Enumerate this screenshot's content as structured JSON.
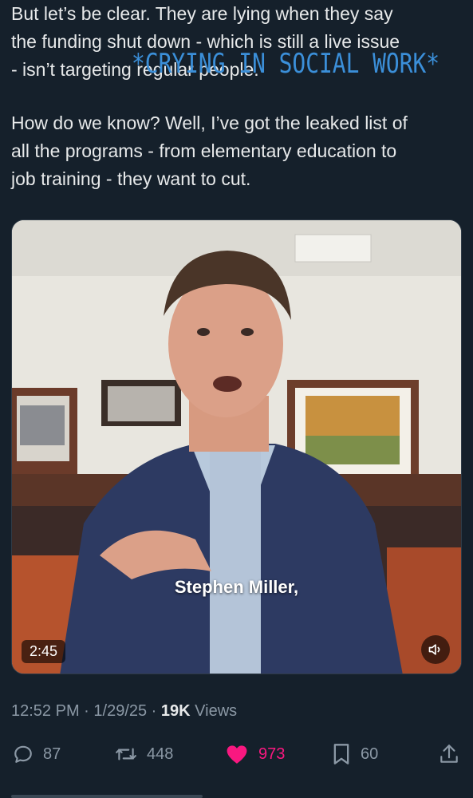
{
  "tweet": {
    "lines": [
      "But let’s be clear. They are lying when they say",
      "the funding shut down - which is still a live issue",
      "- isn’t targeting regular people."
    ],
    "lines2": [
      "How do we know? Well, I’ve got the leaked list of",
      "all the programs - from elementary education to",
      "job training - they want to cut."
    ]
  },
  "overlay": {
    "caption": "*CRYING IN SOCIAL WORK*"
  },
  "video": {
    "subtitle": "Stephen Miller,",
    "duration": "2:45",
    "mute_icon": "speaker-muted-icon"
  },
  "meta": {
    "time": "12:52 PM",
    "date": "1/29/25",
    "separator": " · ",
    "views_count": "19K",
    "views_label": "Views"
  },
  "actions": {
    "replies": "87",
    "reposts": "448",
    "likes": "973",
    "bookmarks": "60"
  },
  "colors": {
    "background": "#15202b",
    "text": "#e7e9ea",
    "muted": "#8b98a5",
    "like": "#f91880",
    "overlay_caption": "#3b8fd9"
  }
}
